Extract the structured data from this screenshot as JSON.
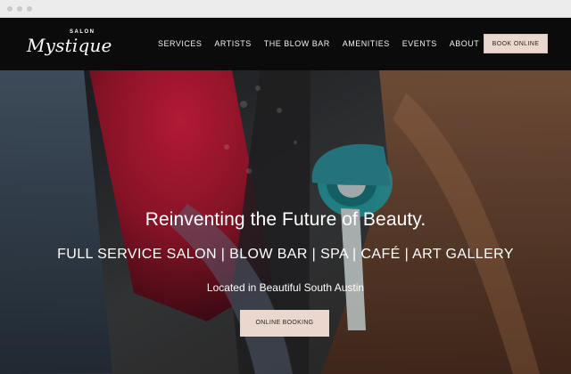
{
  "browser": {
    "controls": [
      "close-dot",
      "minimize-dot",
      "maximize-dot"
    ]
  },
  "header": {
    "logo_small": "SALON",
    "logo_script": "Mystique",
    "nav": [
      "SERVICES",
      "ARTISTS",
      "THE BLOW BAR",
      "AMENITIES",
      "EVENTS",
      "ABOUT"
    ],
    "book_online": "BOOK ONLINE"
  },
  "hero": {
    "headline": "Reinventing the Future of Beauty.",
    "services": "FULL SERVICE SALON | BLOW BAR  | SPA | CAFÉ  |  ART GALLERY",
    "location": "Located in Beautiful South Austin",
    "cta": "ONLINE BOOKING"
  },
  "colors": {
    "header_bg": "#0b0b0b",
    "button_bg": "#ead8cf",
    "button_text": "#2d2320"
  }
}
